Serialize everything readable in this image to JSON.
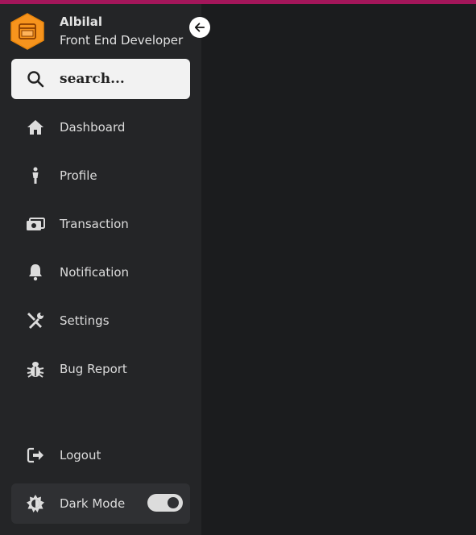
{
  "colors": {
    "accent_strip": "#a3165a",
    "sidebar_bg": "#242527",
    "main_bg": "#1b1c1e",
    "brand_orange": "#f7941d",
    "text": "#dcdcdc"
  },
  "profile": {
    "name": "Albilal",
    "role": "Front End Developer",
    "logo_icon": "hexagon-browser-logo"
  },
  "collapse": {
    "icon": "arrow-left-icon"
  },
  "search": {
    "placeholder": "search...",
    "value": "",
    "icon": "search-icon"
  },
  "nav": [
    {
      "label": "Dashboard",
      "icon": "home-icon"
    },
    {
      "label": "Profile",
      "icon": "person-icon"
    },
    {
      "label": "Transaction",
      "icon": "money-icon"
    },
    {
      "label": "Notification",
      "icon": "bell-icon"
    },
    {
      "label": "Settings",
      "icon": "tools-icon"
    },
    {
      "label": "Bug Report",
      "icon": "bug-icon"
    }
  ],
  "logout": {
    "label": "Logout",
    "icon": "logout-icon"
  },
  "dark_mode": {
    "label": "Dark Mode",
    "icon": "gear-sun-icon",
    "enabled": true
  }
}
